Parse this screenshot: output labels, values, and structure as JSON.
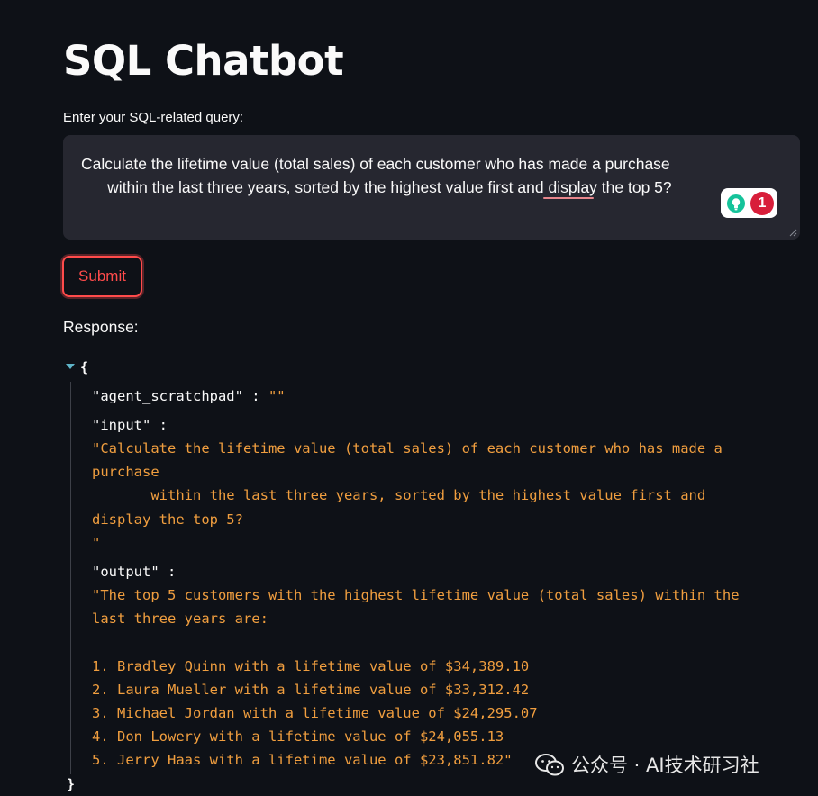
{
  "page": {
    "title": "SQL Chatbot"
  },
  "query": {
    "label": "Enter your SQL-related query:",
    "value": "Calculate the lifetime value (total sales) of each customer who has made a purchase\n      within the last three years, sorted by the highest value first and display the top 5?",
    "grammarly_badge_count": "1"
  },
  "submit": {
    "label": "Submit"
  },
  "response": {
    "label": "Response:",
    "json": {
      "open_brace": "{",
      "close_brace": "}",
      "agent_scratchpad_key": "\"agent_scratchpad\" : ",
      "agent_scratchpad_value": "\"\"",
      "input_key": "\"input\" :",
      "input_value": "\"Calculate the lifetime value (total sales) of each customer who has made a\npurchase\n       within the last three years, sorted by the highest value first and\ndisplay the top 5?\n\"",
      "output_key": "\"output\" :",
      "output_value": "\"The top 5 customers with the highest lifetime value (total sales) within the\nlast three years are:\n\n1. Bradley Quinn with a lifetime value of $34,389.10\n2. Laura Mueller with a lifetime value of $33,312.42\n3. Michael Jordan with a lifetime value of $24,295.07\n4. Don Lowery with a lifetime value of $24,055.13\n5. Jerry Haas with a lifetime value of $23,851.82\""
    }
  },
  "watermark": {
    "text": "公众号 · AI技术研习社"
  },
  "colors": {
    "background": "#0e1117",
    "input_background": "#262730",
    "accent": "#ff4b4b",
    "json_string": "#f09e3f"
  },
  "icons": {
    "grammarly": "lightbulb-icon",
    "toggle": "caret-down-icon",
    "resize": "resize-grip-icon",
    "watermark": "wechat-icon"
  }
}
